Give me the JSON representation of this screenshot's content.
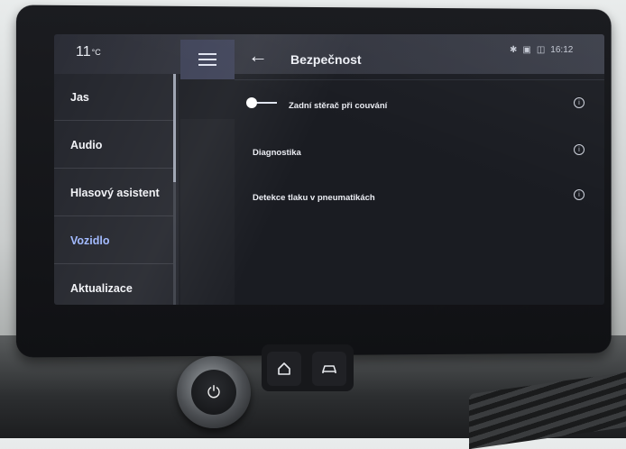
{
  "status_bar": {
    "temperature": "11",
    "temperature_unit": "°C",
    "time": "16:12",
    "icons": [
      "bluetooth-icon",
      "car-connection-icon",
      "signal-icon"
    ]
  },
  "sidebar": {
    "items": [
      {
        "label": "Jas",
        "active": false
      },
      {
        "label": "Audio",
        "active": false
      },
      {
        "label": "Hlasový asistent",
        "active": false
      },
      {
        "label": "Vozidlo",
        "active": true
      },
      {
        "label": "Aktualizace",
        "active": false
      }
    ]
  },
  "header": {
    "title": "Bezpečnost",
    "back_icon": "arrow-left-icon",
    "menu_icon": "hamburger-menu-icon"
  },
  "settings": {
    "rows": [
      {
        "label": "Zadní stěrač při couvání",
        "has_toggle": true,
        "toggle_on": false,
        "info_icon": "info-icon"
      },
      {
        "label": "Diagnostika",
        "has_toggle": false,
        "info_icon": "info-icon"
      },
      {
        "label": "Detekce tlaku v pneumatikách",
        "has_toggle": false,
        "info_icon": "info-icon"
      }
    ]
  },
  "hardware": {
    "power_icon": "power-icon",
    "home_icon": "home-icon",
    "car_icon": "car-icon"
  },
  "colors": {
    "active_item": "#9fb8ff",
    "menu_button_bg": "#3b3f55",
    "screen_bg": "#1a1c22"
  }
}
